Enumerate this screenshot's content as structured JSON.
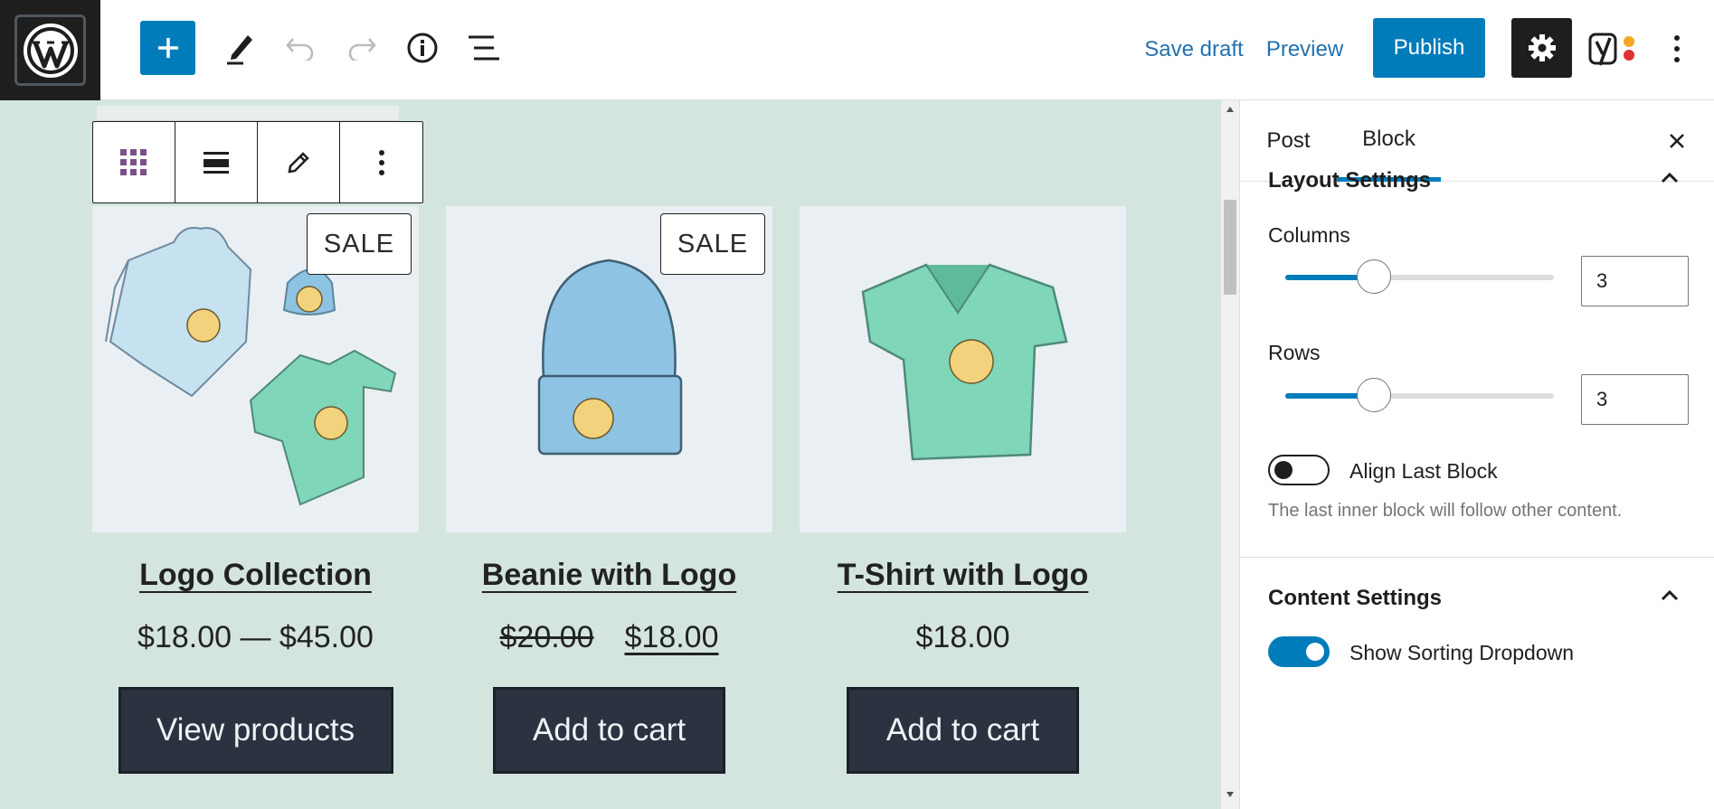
{
  "topbar": {
    "add_block_icon": "plus-icon",
    "tools_icon": "pencil-icon",
    "undo_icon": "undo-icon",
    "redo_icon": "redo-icon",
    "details_icon": "info-icon",
    "list_view_icon": "list-view-icon",
    "save_draft": "Save draft",
    "preview": "Preview",
    "publish": "Publish",
    "settings_icon": "gear-icon",
    "yoast_icon": "yoast-icon",
    "options_icon": "vertical-ellipsis-icon"
  },
  "block_toolbar": {
    "tools": [
      "grid-icon",
      "align-icon",
      "pencil-icon",
      "more-options-icon"
    ]
  },
  "products": [
    {
      "title": "Logo Collection",
      "price": "$18.00 — $45.00",
      "old_price": "",
      "new_price": "",
      "sale_badge": "SALE",
      "button": "View products",
      "image": "logo-collection-image"
    },
    {
      "title": "Beanie with Logo",
      "price": "",
      "old_price": "$20.00",
      "new_price": "$18.00",
      "sale_badge": "SALE",
      "button": "Add to cart",
      "image": "beanie-image"
    },
    {
      "title": "T-Shirt with Logo",
      "price": "$18.00",
      "old_price": "",
      "new_price": "",
      "sale_badge": "",
      "button": "Add to cart",
      "image": "tshirt-image"
    }
  ],
  "sidebar": {
    "tabs": [
      {
        "label": "Post"
      },
      {
        "label": "Block",
        "active": true
      }
    ],
    "close_icon": "close-icon",
    "layout": {
      "title": "Layout Settings",
      "columns_label": "Columns",
      "columns_value": "3",
      "columns_slider_fraction": 0.33,
      "rows_label": "Rows",
      "rows_value": "3",
      "rows_slider_fraction": 0.33,
      "align_last_label": "Align Last Block",
      "align_last_on": false,
      "align_last_help": "The last inner block will follow other content."
    },
    "content": {
      "title": "Content Settings",
      "sorting_label": "Show Sorting Dropdown",
      "sorting_on": true
    }
  },
  "colors": {
    "accent": "#007cba",
    "canvas_bg": "#d4e5df",
    "button_bg": "#2b3340",
    "dark": "#1e1e1e"
  }
}
